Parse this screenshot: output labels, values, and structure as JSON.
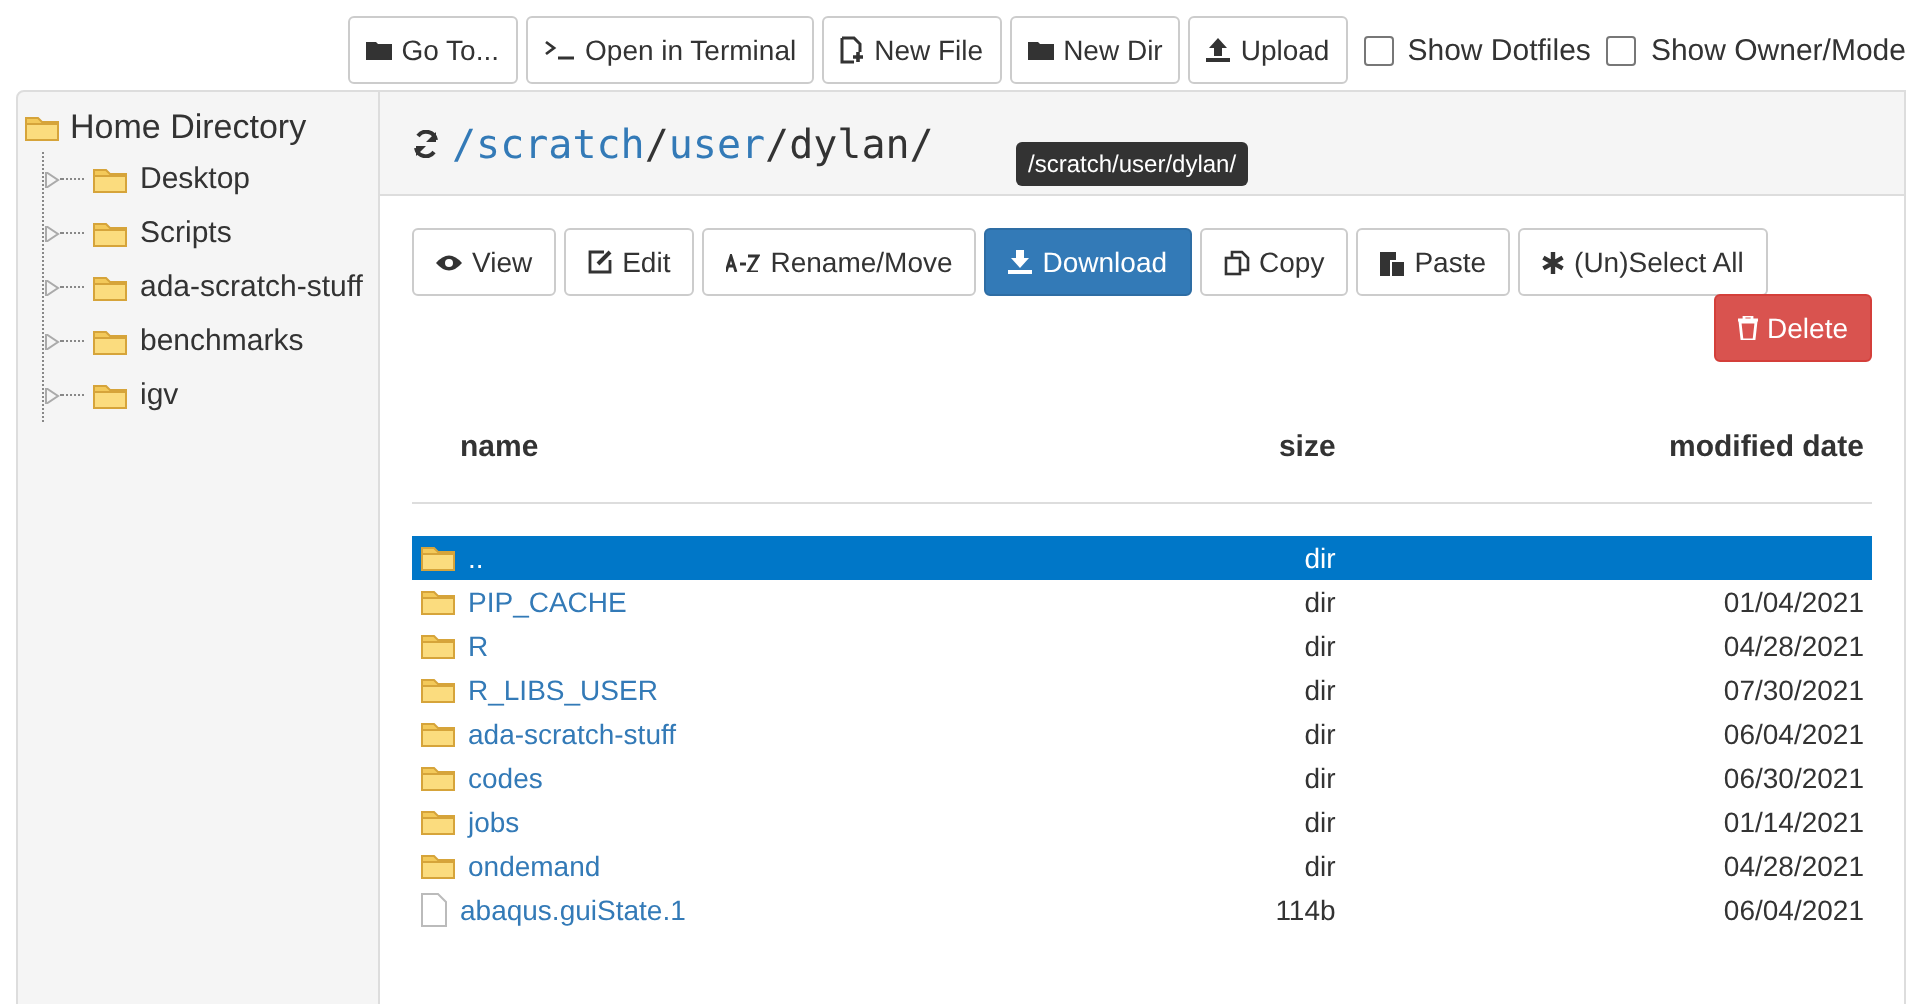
{
  "toolbar": {
    "buttons": [
      {
        "label": "Go To..."
      },
      {
        "label": "Open in Terminal"
      },
      {
        "label": "New File"
      },
      {
        "label": "New Dir"
      },
      {
        "label": "Upload"
      }
    ],
    "checkboxes": [
      {
        "label": "Show Dotfiles",
        "checked": false
      },
      {
        "label": "Show Owner/Mode",
        "checked": false
      }
    ]
  },
  "tree": {
    "label": "Home Directory",
    "children": [
      {
        "label": "Desktop",
        "expanded": false
      },
      {
        "label": "Scripts",
        "expanded": false
      },
      {
        "label": "ada-scratch-stuff",
        "expanded": false
      },
      {
        "label": "benchmarks",
        "expanded": false
      },
      {
        "label": "igv",
        "expanded": false
      }
    ]
  },
  "path": {
    "segments": [
      {
        "text": "/scratch",
        "kind": "link"
      },
      {
        "text": "/",
        "kind": "plain"
      },
      {
        "text": "user",
        "kind": "link"
      },
      {
        "text": "/dylan/",
        "kind": "plain"
      }
    ],
    "tooltip": "/scratch/user/dylan/"
  },
  "actions": [
    {
      "label": "View",
      "kind": "default"
    },
    {
      "label": "Edit",
      "kind": "default"
    },
    {
      "label": "Rename/Move",
      "kind": "default"
    },
    {
      "label": "Download",
      "kind": "primary"
    },
    {
      "label": "Copy",
      "kind": "default"
    },
    {
      "label": "Paste",
      "kind": "default"
    },
    {
      "label": "(Un)Select All",
      "kind": "default"
    },
    {
      "label": "Delete",
      "kind": "danger"
    }
  ],
  "table": {
    "columns": [
      "name",
      "size",
      "modified date"
    ],
    "rows": [
      {
        "name": "..",
        "size": "dir",
        "kind": "folder",
        "selected": true
      },
      {
        "name": "PIP_CACHE",
        "size": "dir",
        "modified": "01/04/2021",
        "kind": "folder",
        "selected": false
      },
      {
        "name": "R",
        "size": "dir",
        "modified": "04/28/2021",
        "kind": "folder",
        "selected": false
      },
      {
        "name": "R_LIBS_USER",
        "size": "dir",
        "modified": "07/30/2021",
        "kind": "folder",
        "selected": false
      },
      {
        "name": "ada-scratch-stuff",
        "size": "dir",
        "modified": "06/04/2021",
        "kind": "folder",
        "selected": false
      },
      {
        "name": "codes",
        "size": "dir",
        "modified": "06/30/2021",
        "kind": "folder",
        "selected": false
      },
      {
        "name": "jobs",
        "size": "dir",
        "modified": "01/14/2021",
        "kind": "folder",
        "selected": false
      },
      {
        "name": "ondemand",
        "size": "dir",
        "modified": "04/28/2021",
        "kind": "folder",
        "selected": false
      },
      {
        "name": "abaqus.guiState.1",
        "size": "114b",
        "modified": "06/04/2021",
        "kind": "file",
        "selected": false
      }
    ]
  }
}
